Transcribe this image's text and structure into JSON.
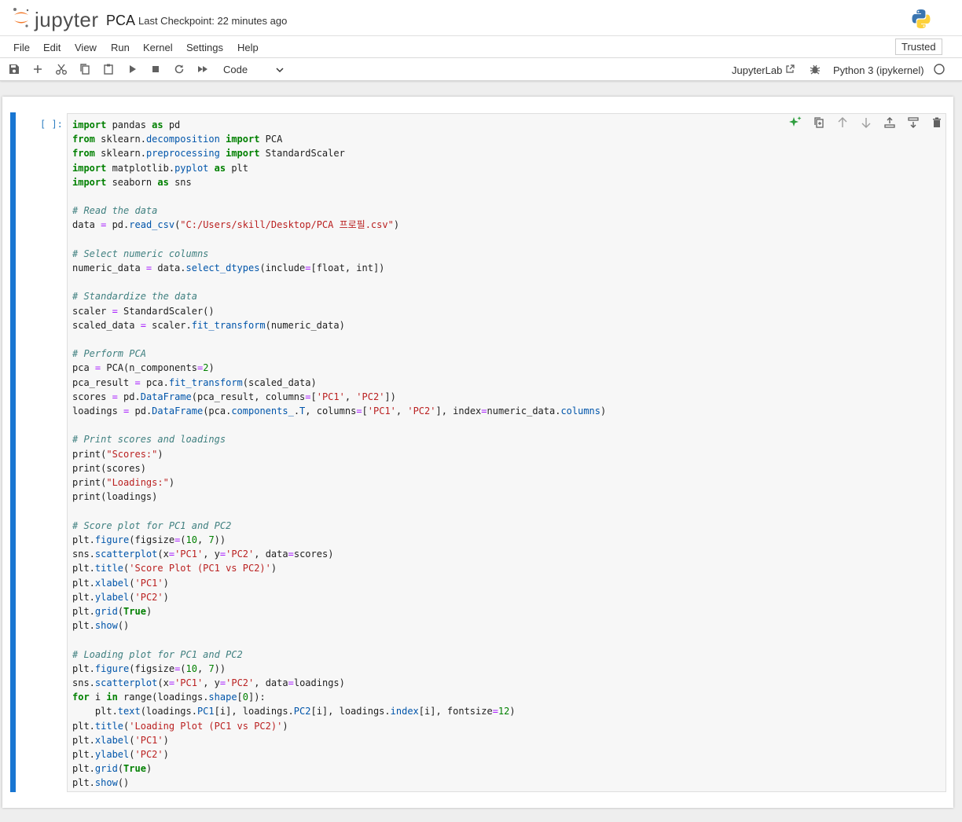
{
  "header": {
    "logo_text": "jupyter",
    "notebook_title": "PCA",
    "checkpoint": "Last Checkpoint: 22 minutes ago"
  },
  "menu": {
    "items": [
      "File",
      "Edit",
      "View",
      "Run",
      "Kernel",
      "Settings",
      "Help"
    ],
    "trusted": "Trusted"
  },
  "toolbar": {
    "cell_type": "Code",
    "jupyterlab_label": "JupyterLab",
    "kernel_name": "Python 3 (ipykernel)",
    "kernel_status": "idle"
  },
  "cell": {
    "prompt": "[ ]:",
    "code_lines": [
      "import pandas as pd",
      "from sklearn.decomposition import PCA",
      "from sklearn.preprocessing import StandardScaler",
      "import matplotlib.pyplot as plt",
      "import seaborn as sns",
      "",
      "# Read the data",
      "data = pd.read_csv(\"C:/Users/skill/Desktop/PCA 프로필.csv\")",
      "",
      "# Select numeric columns",
      "numeric_data = data.select_dtypes(include=[float, int])",
      "",
      "# Standardize the data",
      "scaler = StandardScaler()",
      "scaled_data = scaler.fit_transform(numeric_data)",
      "",
      "# Perform PCA",
      "pca = PCA(n_components=2)",
      "pca_result = pca.fit_transform(scaled_data)",
      "scores = pd.DataFrame(pca_result, columns=['PC1', 'PC2'])",
      "loadings = pd.DataFrame(pca.components_.T, columns=['PC1', 'PC2'], index=numeric_data.columns)",
      "",
      "# Print scores and loadings",
      "print(\"Scores:\")",
      "print(scores)",
      "print(\"Loadings:\")",
      "print(loadings)",
      "",
      "# Score plot for PC1 and PC2",
      "plt.figure(figsize=(10, 7))",
      "sns.scatterplot(x='PC1', y='PC2', data=scores)",
      "plt.title('Score Plot (PC1 vs PC2)')",
      "plt.xlabel('PC1')",
      "plt.ylabel('PC2')",
      "plt.grid(True)",
      "plt.show()",
      "",
      "# Loading plot for PC1 and PC2",
      "plt.figure(figsize=(10, 7))",
      "sns.scatterplot(x='PC1', y='PC2', data=loadings)",
      "for i in range(loadings.shape[0]):",
      "    plt.text(loadings.PC1[i], loadings.PC2[i], loadings.index[i], fontsize=12)",
      "plt.title('Loading Plot (PC1 vs PC2)')",
      "plt.xlabel('PC1')",
      "plt.ylabel('PC2')",
      "plt.grid(True)",
      "plt.show()"
    ]
  },
  "colors": {
    "accent": "#1976d2",
    "jupyter_orange": "#f37726",
    "keyword": "#008000",
    "string": "#ba2121",
    "comment": "#408080",
    "operator": "#aa22ff",
    "property": "#0055aa",
    "prompt": "#307fc1"
  },
  "icons": {
    "toolbar": [
      "save-icon",
      "add-cell-icon",
      "cut-icon",
      "copy-icon",
      "paste-icon",
      "run-icon",
      "stop-icon",
      "restart-icon",
      "fast-forward-icon"
    ],
    "cell_actions": [
      "ai-sparkle-icon",
      "duplicate-icon",
      "move-up-icon",
      "move-down-icon",
      "insert-above-icon",
      "insert-below-icon",
      "delete-icon"
    ]
  }
}
